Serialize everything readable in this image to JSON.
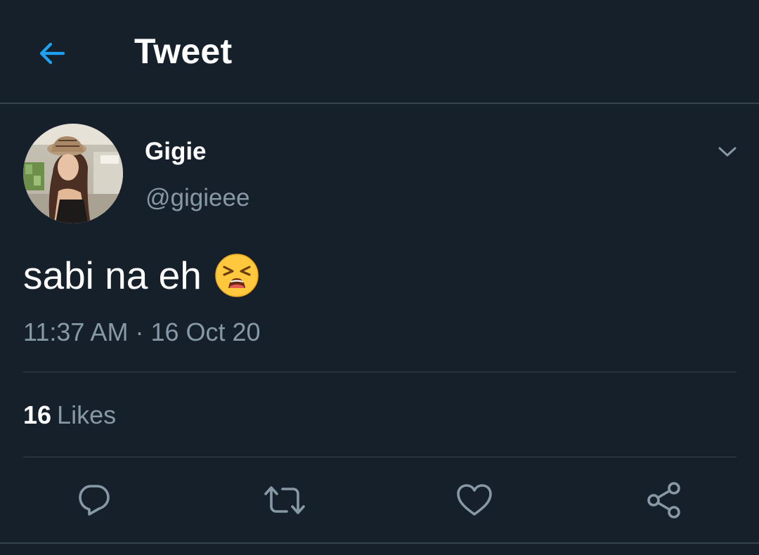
{
  "header": {
    "back_icon": "arrow-left-icon",
    "title": "Tweet"
  },
  "author": {
    "display_name": "Gigie",
    "handle": "@gigieee",
    "avatar": "profile-photo"
  },
  "tweet": {
    "text": "sabi na eh",
    "emoji": "tired-face-emoji",
    "time": "11:37 AM",
    "separator": "·",
    "date": "16 Oct 20"
  },
  "stats": {
    "likes_count": "16",
    "likes_label": "Likes"
  },
  "actions": {
    "reply_icon": "reply-icon",
    "retweet_icon": "retweet-icon",
    "like_icon": "heart-icon",
    "share_icon": "share-icon"
  },
  "colors": {
    "background": "#15202b",
    "accent": "#1da1f2",
    "secondary_text": "#8899a6",
    "divider": "#38444d"
  }
}
